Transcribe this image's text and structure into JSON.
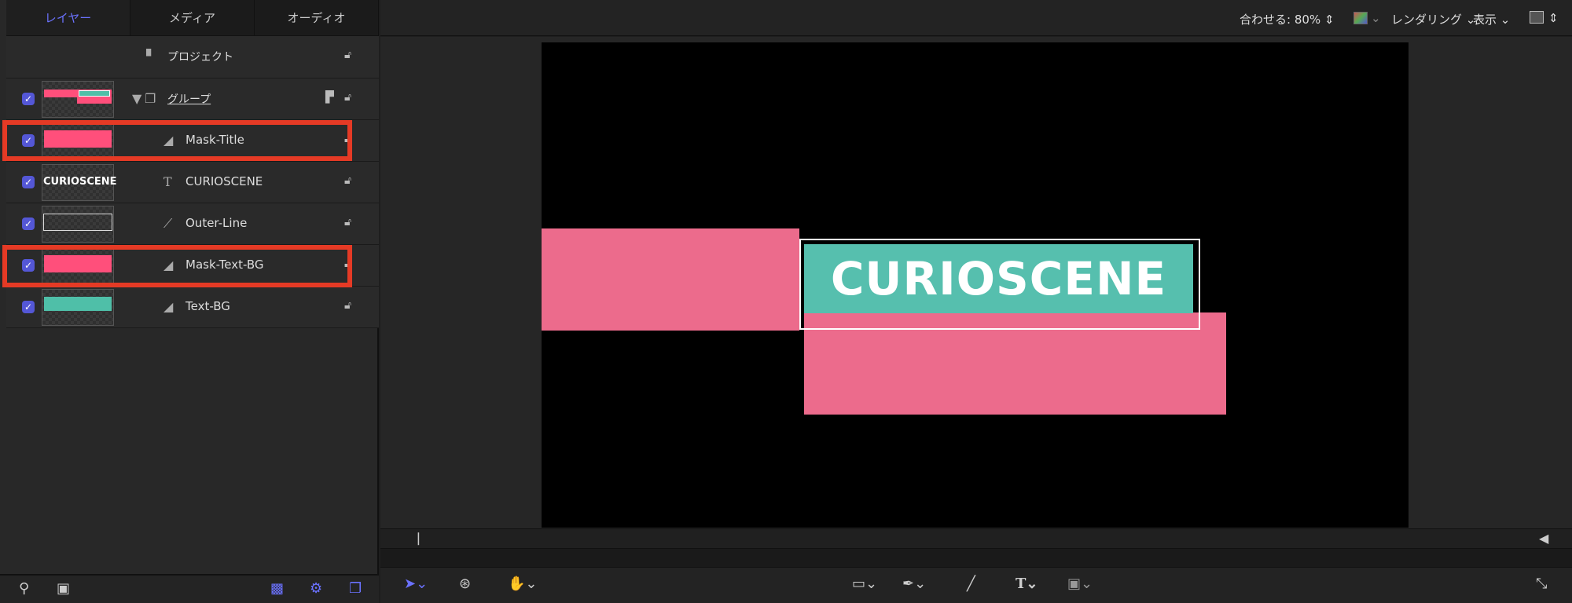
{
  "tabs": [
    "レイヤー",
    "メディア",
    "オーディオ"
  ],
  "project": {
    "label": "プロジェクト"
  },
  "layers": [
    {
      "name": "グループ",
      "type": "group",
      "checked": true
    },
    {
      "name": "Mask-Title",
      "type": "mask",
      "checked": true,
      "highlighted": true,
      "thumb_color": "#ff4f7b"
    },
    {
      "name": "CURIOSCENE",
      "type": "text",
      "checked": true,
      "thumb_text": "CURIOSCENE"
    },
    {
      "name": "Outer-Line",
      "type": "line",
      "checked": true
    },
    {
      "name": "Mask-Text-BG",
      "type": "mask",
      "checked": true,
      "highlighted": true,
      "thumb_color": "#ff4f7b"
    },
    {
      "name": "Text-BG",
      "type": "shape",
      "checked": true,
      "thumb_color": "#4fbfa8"
    }
  ],
  "viewer": {
    "fit": "合わせる: 80%",
    "render": "レンダリング",
    "view": "表示"
  },
  "canvas": {
    "title_text": "CURIOSCENE",
    "pink": "#ec6b8c",
    "teal": "#56bfae",
    "highlight": "#e53a25",
    "accent": "#5457d6"
  }
}
